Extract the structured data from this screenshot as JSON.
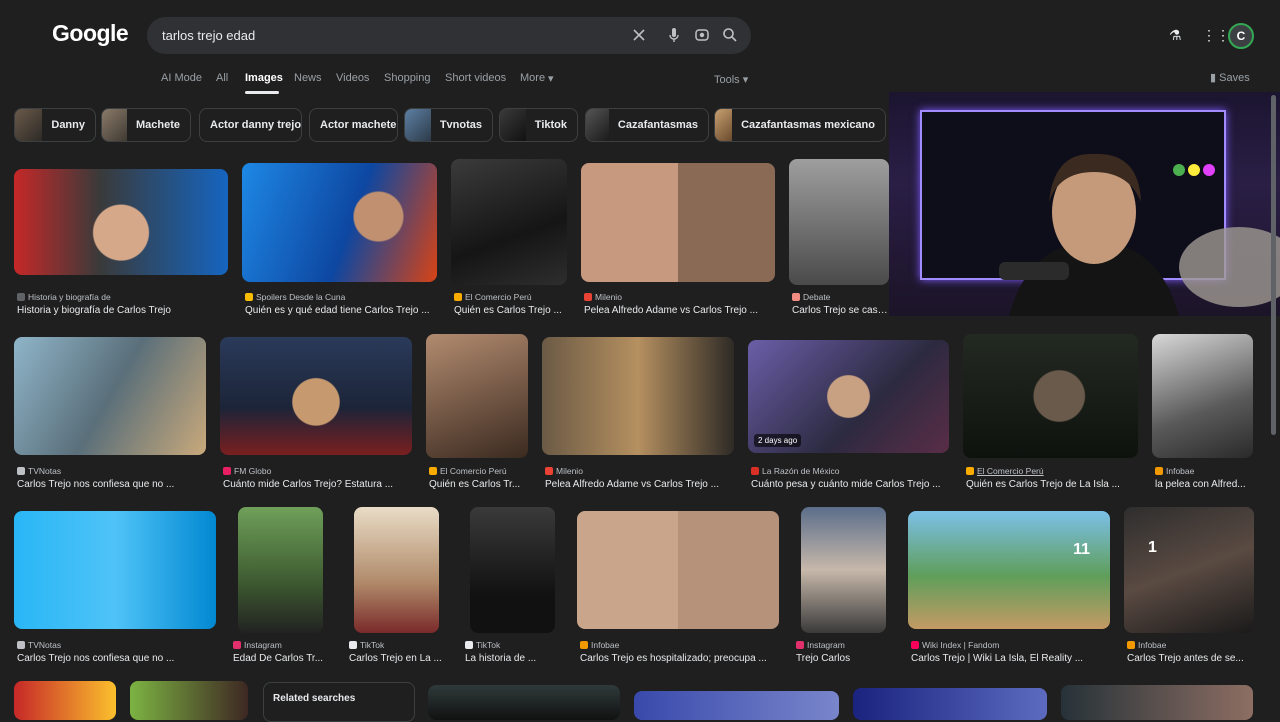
{
  "logo": "Google",
  "search": {
    "query": "tarlos trejo edad"
  },
  "tabs": [
    "AI Mode",
    "All",
    "Images",
    "News",
    "Videos",
    "Shopping",
    "Short videos",
    "More"
  ],
  "tools": "Tools",
  "saves": "Saves",
  "avatar": "C",
  "chips": [
    "Danny",
    "Machete",
    "Actor danny trejo",
    "Actor machete",
    "Tvnotas",
    "Tiktok",
    "Cazafantasmas",
    "Cazafantasmas mexicano"
  ],
  "results": [
    {
      "source": "Historia y biografía de",
      "title": "Historia y biografía de Carlos Trejo",
      "fav": "#5f6368"
    },
    {
      "source": "Spoilers Desde la Cuna",
      "title": "Quién es y qué edad tiene Carlos Trejo ...",
      "fav": "#fbbc04"
    },
    {
      "source": "El Comercio Perú",
      "title": "Quién es Carlos Trejo ...",
      "fav": "#f9ab00"
    },
    {
      "source": "Milenio",
      "title": "Pelea Alfredo Adame vs Carlos Trejo ...",
      "fav": "#ea4335"
    },
    {
      "source": "Debate",
      "title": "Carlos Trejo se casó c",
      "fav": "#f28b82"
    },
    {
      "source": "TVNotas",
      "title": "Carlos Trejo nos confiesa que no ...",
      "fav": "#bdc1c6"
    },
    {
      "source": "FM Globo",
      "title": "Cuánto mide Carlos Trejo? Estatura ...",
      "fav": "#e91e63"
    },
    {
      "source": "El Comercio Perú",
      "title": "Quién es Carlos Tr...",
      "fav": "#f9ab00"
    },
    {
      "source": "Milenio",
      "title": "Pelea Alfredo Adame vs Carlos Trejo ...",
      "fav": "#ea4335"
    },
    {
      "source": "La Razón de México",
      "title": "Cuánto pesa y cuánto mide Carlos Trejo ...",
      "fav": "#d93025"
    },
    {
      "source": "El Comercio Perú",
      "title": "Quién es Carlos Trejo de La Isla ...",
      "fav": "#f9ab00"
    },
    {
      "source": "Infobae",
      "title": "la pelea con Alfred...",
      "fav": "#f29900"
    },
    {
      "source": "TVNotas",
      "title": "Carlos Trejo nos confiesa que no ...",
      "fav": "#bdc1c6"
    },
    {
      "source": "Instagram",
      "title": "Edad De Carlos Tr...",
      "fav": "#e1306c"
    },
    {
      "source": "TikTok",
      "title": "Carlos Trejo en La ...",
      "fav": "#e8eaed"
    },
    {
      "source": "TikTok",
      "title": "La historia de ...",
      "fav": "#e8eaed"
    },
    {
      "source": "Infobae",
      "title": "Carlos Trejo es hospitalizado; preocupa ...",
      "fav": "#f29900"
    },
    {
      "source": "Instagram",
      "title": "Trejo Carlos",
      "fav": "#e1306c"
    },
    {
      "source": "Wiki Index | Fandom",
      "title": "Carlos Trejo | Wiki La Isla, El Reality ...",
      "fav": "#fa005a"
    },
    {
      "source": "Infobae",
      "title": "Carlos Trejo antes de se...",
      "fav": "#f29900"
    }
  ],
  "badge_days": "2 days ago",
  "overlay_numbers": [
    "11",
    "1"
  ],
  "related_searches": "Related searches"
}
